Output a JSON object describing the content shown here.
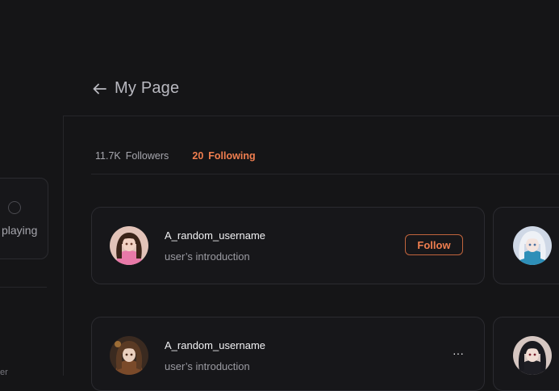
{
  "header": {
    "title": "My Page",
    "back_label": "back"
  },
  "sidebar": {
    "card_fragment": "playing",
    "bottom_fragment": "er"
  },
  "tabs": [
    {
      "count": "11.7K",
      "label": "Followers",
      "active": false
    },
    {
      "count": "20",
      "label": "Following",
      "active": true
    }
  ],
  "users": [
    {
      "username": "A_random_username",
      "intro": "user’s introduction",
      "action": "Follow"
    },
    {
      "username": "A_random_username",
      "intro": "user’s introduction",
      "action": "···"
    }
  ],
  "colors": {
    "accent": "#f07e4f",
    "background": "#151517",
    "card_border": "#2b2b30"
  },
  "icons": [
    "arrow-left-icon",
    "more-horizontal-icon"
  ]
}
